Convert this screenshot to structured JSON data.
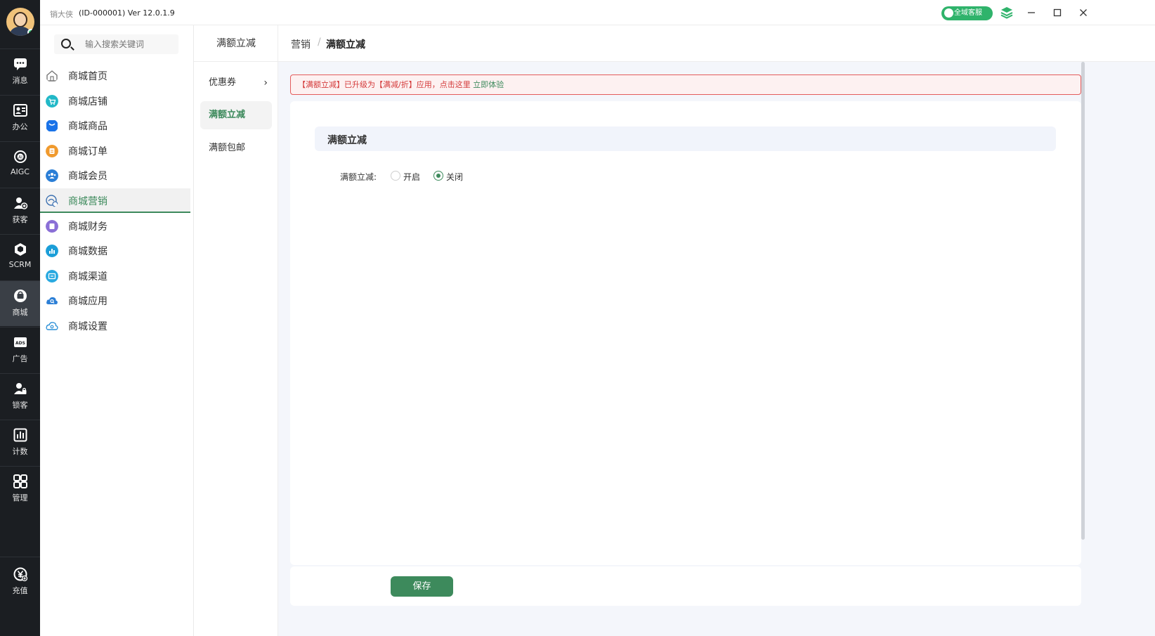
{
  "titlebar": {
    "app_name": "销大侠",
    "version_info": "(ID-000001)  Ver 12.0.1.9",
    "service_label": "全域客服"
  },
  "rail": {
    "items": [
      {
        "label": "消息",
        "icon": "chat-icon"
      },
      {
        "label": "办公",
        "icon": "contact-card-icon"
      },
      {
        "label": "AIGC",
        "icon": "ai-icon"
      },
      {
        "label": "获客",
        "icon": "user-plus-icon"
      },
      {
        "label": "SCRM",
        "icon": "cube-icon"
      },
      {
        "label": "商城",
        "icon": "shop-icon"
      },
      {
        "label": "广告",
        "icon": "ads-icon"
      },
      {
        "label": "锁客",
        "icon": "user-lock-icon"
      },
      {
        "label": "计数",
        "icon": "bar-chart-icon"
      },
      {
        "label": "管理",
        "icon": "grid-icon"
      }
    ],
    "recharge": {
      "label": "充值",
      "icon": "yen-icon"
    }
  },
  "search": {
    "placeholder": "输入搜索关键词"
  },
  "menu": {
    "items": [
      {
        "label": "商城首页",
        "color": "#888888"
      },
      {
        "label": "商城店铺",
        "color": "#22b8c7"
      },
      {
        "label": "商城商品",
        "color": "#1a73e8"
      },
      {
        "label": "商城订单",
        "color": "#f09a2e"
      },
      {
        "label": "商城会员",
        "color": "#2a7ed6"
      },
      {
        "label": "商城营销",
        "color": "#3a6fb0"
      },
      {
        "label": "商城财务",
        "color": "#8a6fd6"
      },
      {
        "label": "商城数据",
        "color": "#1b9ed8"
      },
      {
        "label": "商城渠道",
        "color": "#29a9e0"
      },
      {
        "label": "商城应用",
        "color": "#2c7fd6"
      },
      {
        "label": "商城设置",
        "color": "#2a8fd6"
      }
    ]
  },
  "submenu": {
    "title": "满额立减",
    "items": [
      "优惠券",
      "满额立减",
      "满额包邮"
    ]
  },
  "breadcrumb": {
    "parent": "营销",
    "separator": "/",
    "current": "满额立减"
  },
  "notice": {
    "text": "【满额立减】已升级为【满减/折】应用，点击这里 ",
    "link": "立即体验"
  },
  "section": {
    "title": "满额立减"
  },
  "form": {
    "label": "满额立减:",
    "options": [
      "开启",
      "关闭"
    ],
    "selected": "关闭"
  },
  "footer": {
    "save_label": "保存"
  },
  "colors": {
    "accent": "#3d8a5c",
    "rail_bg": "#1b1e22",
    "notice_border": "#e45b5b"
  }
}
